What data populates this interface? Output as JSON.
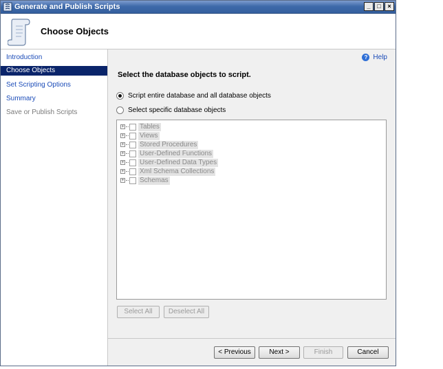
{
  "window": {
    "title": "Generate and Publish Scripts",
    "controls": [
      "_",
      "□",
      "×"
    ]
  },
  "header": {
    "page_title": "Choose Objects",
    "icon": "scroll-icon"
  },
  "sidebar": {
    "items": [
      {
        "label": "Introduction",
        "state": "link"
      },
      {
        "label": "Choose Objects",
        "state": "active"
      },
      {
        "label": "Set Scripting Options",
        "state": "link"
      },
      {
        "label": "Summary",
        "state": "link"
      },
      {
        "label": "Save or Publish Scripts",
        "state": "disabled"
      }
    ]
  },
  "content": {
    "help_label": "Help",
    "instruction": "Select the database objects to script.",
    "options": [
      {
        "label": "Script entire database and all database objects",
        "selected": true
      },
      {
        "label": "Select specific database objects",
        "selected": false
      }
    ],
    "tree_items": [
      "Tables",
      "Views",
      "Stored Procedures",
      "User-Defined Functions",
      "User-Defined Data Types",
      "Xml Schema Collections",
      "Schemas"
    ],
    "select_all": "Select All",
    "deselect_all": "Deselect All"
  },
  "footer": {
    "previous": "< Previous",
    "next": "Next >",
    "finish": "Finish",
    "cancel": "Cancel"
  }
}
